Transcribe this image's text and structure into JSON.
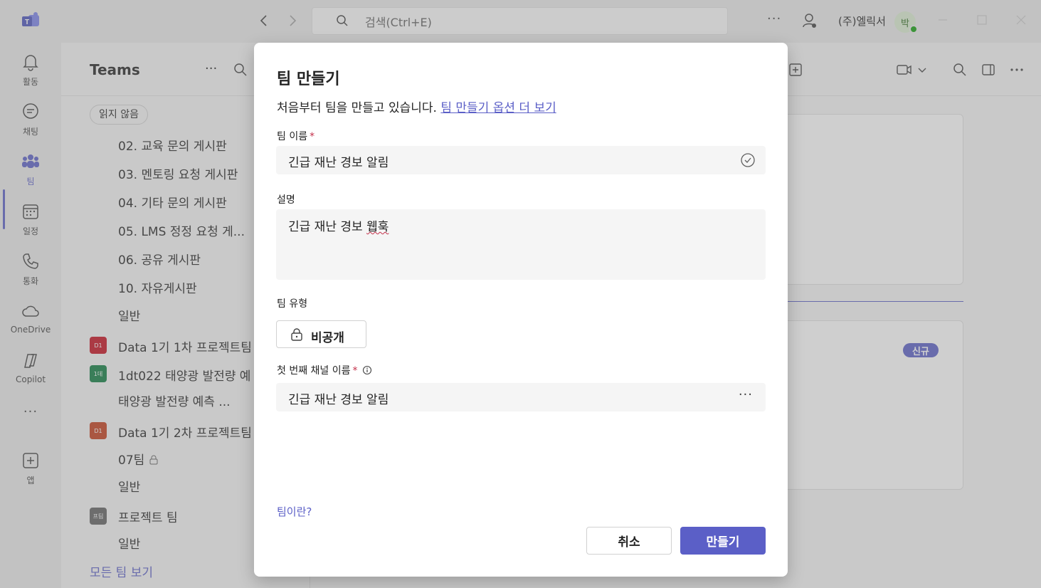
{
  "titlebar": {
    "search_placeholder": "검색(Ctrl+E)",
    "more": "···",
    "org_name": "(주)엘릭서",
    "avatar_initial": "박"
  },
  "rail": {
    "items": [
      {
        "label": "활동",
        "icon": "bell-icon"
      },
      {
        "label": "채팅",
        "icon": "chat-icon"
      },
      {
        "label": "팀",
        "icon": "teams-icon",
        "active": true
      },
      {
        "label": "일정",
        "icon": "calendar-icon"
      },
      {
        "label": "통화",
        "icon": "phone-icon"
      },
      {
        "label": "OneDrive",
        "icon": "cloud-icon"
      },
      {
        "label": "Copilot",
        "icon": "copilot-icon"
      },
      {
        "label": "",
        "icon": "more-icon"
      },
      {
        "label": "앱",
        "icon": "add-app-icon"
      }
    ],
    "more": "···"
  },
  "teams_panel": {
    "title": "Teams",
    "more": "···",
    "filter_chip": "읽지 않음",
    "channels": [
      "02. 교육 문의 게시판",
      "03. 멘토링 요청 게시판",
      "04. 기타 문의 게시판",
      "05. LMS 정정 요청 게...",
      "06. 공유 게시판",
      "10. 자유게시판",
      "일반"
    ],
    "teams": [
      {
        "badge": "D1",
        "name": "Data 1기 1차 프로젝트팀",
        "color": "#c50f1f"
      },
      {
        "badge": "1데",
        "name": "1dt022 태양광 발전량 예",
        "color": "#107c41"
      },
      {
        "badge": "D1",
        "name": "Data 1기 2차 프로젝트팀",
        "color": "#c43e1c"
      },
      {
        "badge": "프팀",
        "name": "프로젝트 팀",
        "color": "#616161"
      }
    ],
    "sub_channels": {
      "solar_channel": "태양광 발전량 예측 ...",
      "team07": "07팀",
      "general_a": "일반",
      "general_b": "일반"
    },
    "see_all": "모든 팀 보기"
  },
  "main": {
    "new_badge": "신규"
  },
  "dialog": {
    "title": "팀 만들기",
    "subtitle": "처음부터 팀을 만들고 있습니다.",
    "more_options_link": "팀 만들기 옵션 더 보기",
    "team_name_label": "팀 이름",
    "required_mark": "*",
    "team_name_value": "긴급 재난 경보 알림",
    "description_label": "설명",
    "description_prefix": "긴급 재난 경보 ",
    "description_misspelled": "웹훅",
    "team_type_label": "팀 유형",
    "team_type_value": "비공개",
    "first_channel_label": "첫 번째 채널 이름",
    "first_channel_value": "긴급 재난 경보 알림",
    "channel_more": "···",
    "what_is_team_link": "팀이란?",
    "cancel_label": "취소",
    "create_label": "만들기"
  }
}
